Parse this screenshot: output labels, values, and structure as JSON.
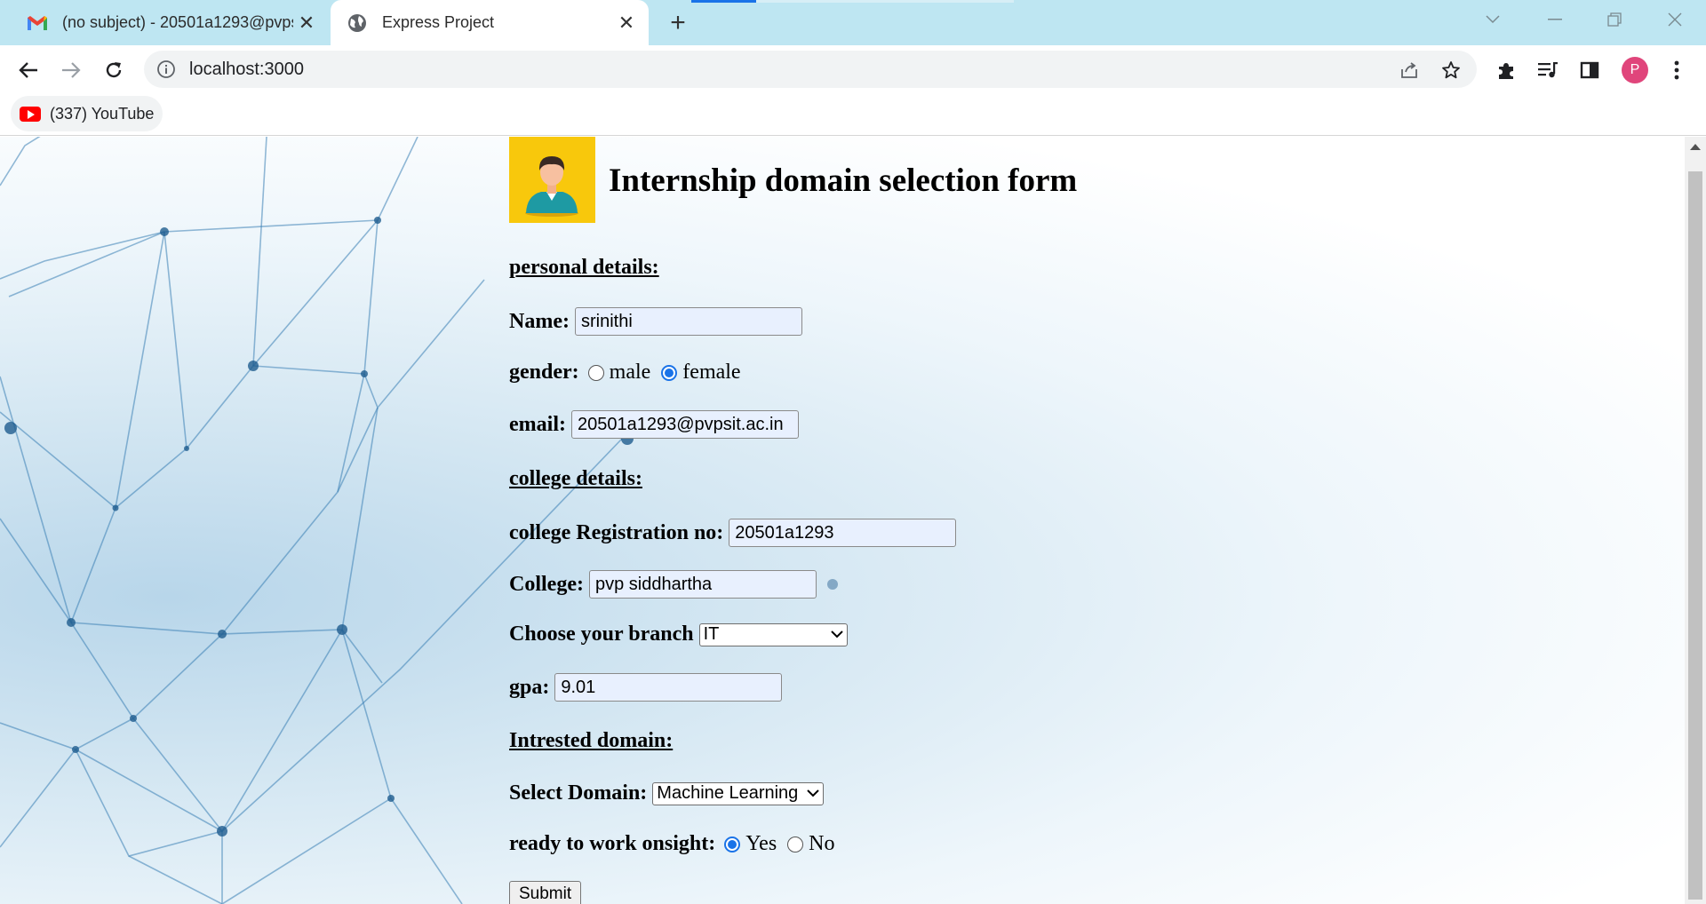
{
  "browser": {
    "tabs": [
      {
        "title": "(no subject) - 20501a1293@pvps",
        "icon": "gmail-icon",
        "active": false
      },
      {
        "title": "Express Project",
        "icon": "globe-icon",
        "active": true
      }
    ],
    "new_tab": "+",
    "close_glyph": "✕",
    "url": "localhost:3000",
    "profile_initial": "P",
    "bookmarks": [
      {
        "label": "(337) YouTube",
        "icon": "youtube-icon"
      }
    ]
  },
  "page": {
    "heading": "Internship domain selection form",
    "sections": {
      "personal": "personal details:",
      "college": "college details:",
      "interested": "Intrested domain:"
    },
    "fields": {
      "name_label": "Name:",
      "name_value": "srinithi",
      "gender_label": "gender:",
      "gender_options": [
        "male",
        "female"
      ],
      "gender_selected": "female",
      "email_label": "email:",
      "email_value": "20501a1293@pvpsit.ac.in",
      "regno_label": "college Registration no:",
      "regno_value": "20501a1293",
      "college_label": "College:",
      "college_value": "pvp siddhartha",
      "branch_label": "Choose your branch",
      "branch_value": "IT",
      "gpa_label": "gpa:",
      "gpa_value": "9.01",
      "domain_label": "Select Domain:",
      "domain_value": "Machine Learning",
      "onsite_label": "ready to work onsight:",
      "onsite_options": [
        "Yes",
        "No"
      ],
      "onsite_selected": "Yes"
    },
    "submit_label": "Submit"
  },
  "colors": {
    "tabstrip": "#bee6f2",
    "accent": "#1a73e8",
    "logo_bg": "#f8c80c",
    "input_autofill": "#e8f0fe"
  }
}
